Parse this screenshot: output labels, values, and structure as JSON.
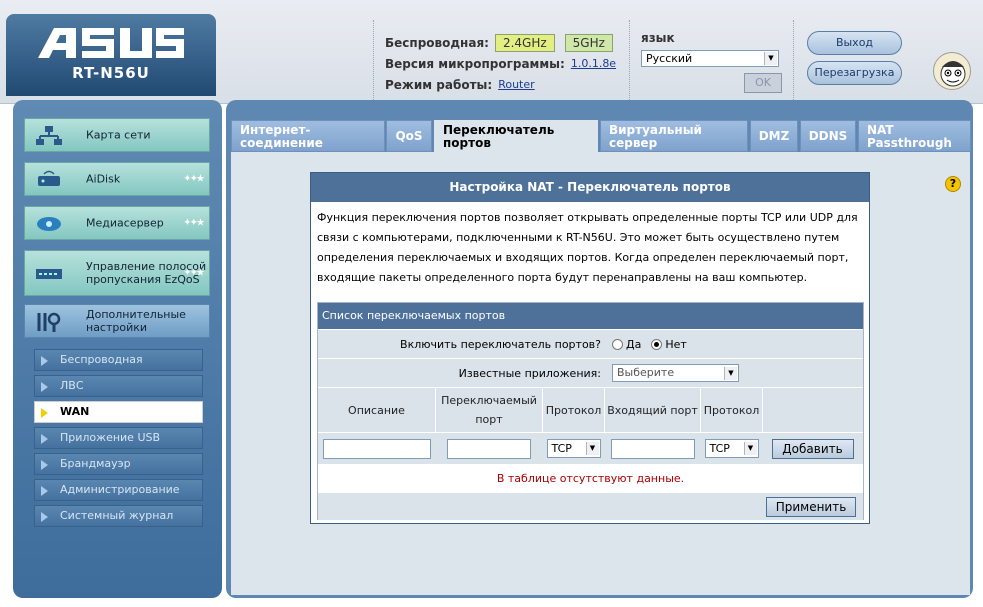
{
  "header": {
    "brand": "ASUS",
    "model": "RT-N56U",
    "wireless_label": "Беспроводная:",
    "band_24": "2.4GHz",
    "band_5": "5GHz",
    "firmware_label": "Версия микропрограммы:",
    "firmware_value": "1.0.1.8e",
    "mode_label": "Режим работы:",
    "mode_value": "Router",
    "language_label": "язык",
    "language_value": "Русский",
    "ok_label": "OK",
    "logout_label": "Выход",
    "reboot_label": "Перезагрузка"
  },
  "sidebar": {
    "items": [
      {
        "label": "Карта сети",
        "icon": "network-map-icon"
      },
      {
        "label": "AiDisk",
        "icon": "disk-icon"
      },
      {
        "label": "Медиасервер",
        "icon": "media-server-icon"
      },
      {
        "label": "Управление полосой пропускания EzQoS",
        "icon": "bandwidth-icon"
      },
      {
        "label": "Дополнительные настройки",
        "icon": "tools-icon"
      }
    ],
    "subitems": [
      {
        "label": "Беспроводная"
      },
      {
        "label": "ЛВС"
      },
      {
        "label": "WAN",
        "active": true
      },
      {
        "label": "Приложение USB"
      },
      {
        "label": "Брандмауэр"
      },
      {
        "label": "Администрирование"
      },
      {
        "label": "Системный журнал"
      }
    ]
  },
  "tabs": [
    {
      "label": "Интернет-\nсоединение"
    },
    {
      "label": "QoS"
    },
    {
      "label": "Переключатель\nпортов",
      "active": true
    },
    {
      "label": "Виртуальный\nсервер"
    },
    {
      "label": "DMZ"
    },
    {
      "label": "DDNS"
    },
    {
      "label": "NAT\nPassthrough"
    }
  ],
  "panel": {
    "title": "Настройка NAT - Переключатель портов",
    "description": "Функция переключения портов позволяет открывать определенные порты TCP или UDP для связи с компьютерами, подключенными к RT-N56U. Это может быть осуществлено путем определения переключаемых и входящих портов. Когда определен переключаемый порт, входящие пакеты определенного порта будут перенаправлены на ваш компьютер.",
    "list_title": "Список переключаемых портов",
    "enable_label": "Включить переключатель портов?",
    "yes_label": "Да",
    "no_label": "Нет",
    "enable_value": "Нет",
    "known_apps_label": "Известные приложения:",
    "known_apps_value": "Выберите",
    "columns": [
      "Описание",
      "Переключаемый порт",
      "Протокол",
      "Входящий порт",
      "Протокол"
    ],
    "protocol_1": "TCP",
    "protocol_2": "TCP",
    "add_label": "Добавить",
    "empty_text": "В таблице отсутствуют данные.",
    "apply_label": "Применить"
  },
  "colors": {
    "accent": "#4e719a",
    "sidebar": "#4a78a6",
    "band_24_bg": "#e4ef83",
    "band_5_bg": "#cfe7a8",
    "empty_text": "#aa0000"
  }
}
